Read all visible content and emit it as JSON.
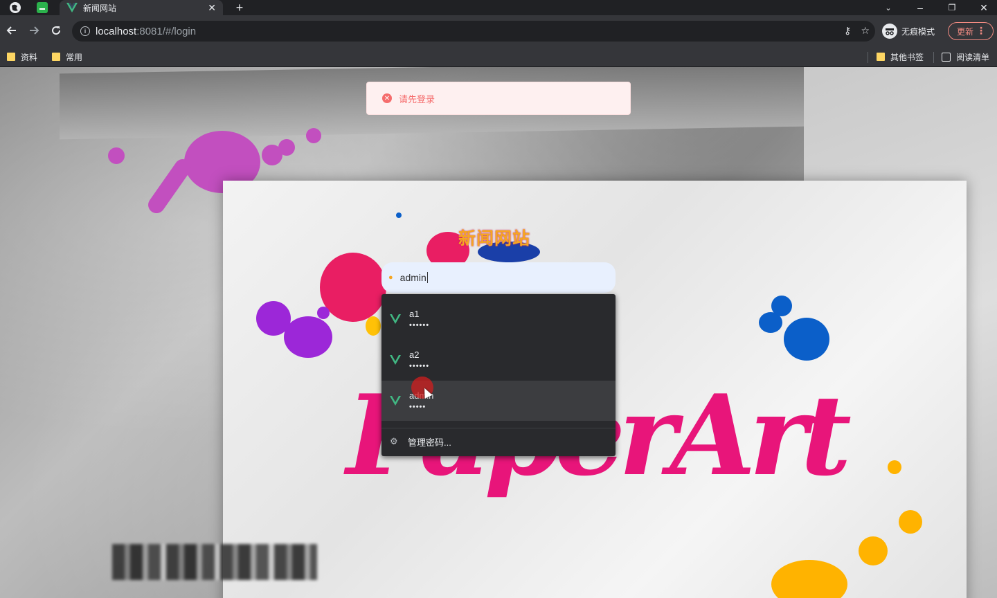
{
  "browser": {
    "tab_title": "新闻网站",
    "url_host": "localhost",
    "url_path": ":8081/#/login",
    "incognito_label": "无痕模式",
    "update_label": "更新",
    "bookmarks": [
      "资料",
      "常用"
    ],
    "other_bookmarks": "其他书签",
    "reading_list": "阅读清单"
  },
  "toast": {
    "message": "请先登录"
  },
  "login": {
    "site_title": "新闻网站",
    "username_value": "admin",
    "background_text": "PaperArt"
  },
  "autofill": {
    "items": [
      {
        "username": "a1",
        "password_mask": "••••••"
      },
      {
        "username": "a2",
        "password_mask": "••••••"
      },
      {
        "username": "admin",
        "password_mask": "•••••"
      }
    ],
    "manage_label": "管理密码..."
  },
  "colors": {
    "accent": "#f5a623",
    "error": "#f56c6c",
    "vue_green": "#41b883"
  }
}
